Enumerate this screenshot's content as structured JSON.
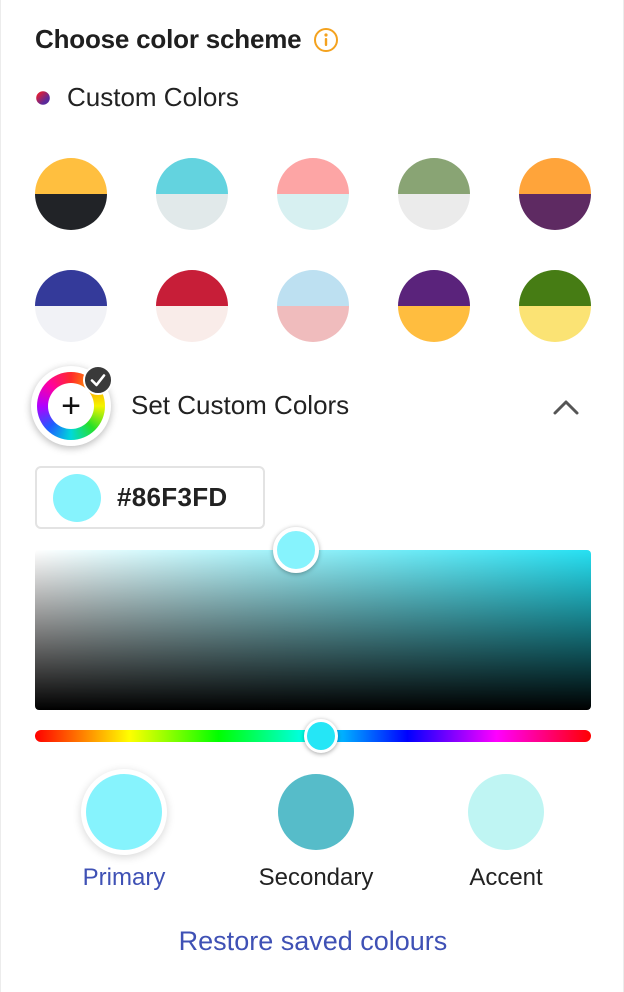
{
  "header": {
    "title": "Choose color scheme",
    "info_icon": "info-circle-icon",
    "info_color": "#f4a21e"
  },
  "current_scheme": {
    "label": "Custom Colors",
    "icon": "color-dot-icon"
  },
  "swatches": [
    {
      "top": "#ffbf3f",
      "bottom": "#212327"
    },
    {
      "top": "#63d3df",
      "bottom": "#e1e9ea"
    },
    {
      "top": "#fda5a5",
      "bottom": "#d7f0f1"
    },
    {
      "top": "#89a474",
      "bottom": "#ebebeb"
    },
    {
      "top": "#ffa43a",
      "bottom": "#5e2a62"
    },
    {
      "top": "#343a9a",
      "bottom": "#f1f2f6"
    },
    {
      "top": "#c71e38",
      "bottom": "#f9ece9"
    },
    {
      "top": "#bde0f1",
      "bottom": "#f0bcbd"
    },
    {
      "top": "#5a237b",
      "bottom": "#ffbd3f"
    },
    {
      "top": "#467c14",
      "bottom": "#fbe374"
    }
  ],
  "custom": {
    "label": "Set Custom Colors",
    "wheel_icon": "color-wheel-plus-icon",
    "check_icon": "check-icon",
    "toggle_icon": "chevron-up-icon",
    "expanded": true
  },
  "picker": {
    "hex": "#86F3FD",
    "saturation": 0.47,
    "brightness": 1.0,
    "hue_fraction": 0.515,
    "hue_handle_color": "#25e6f6"
  },
  "roles": [
    {
      "label": "Primary",
      "color": "#86f3fd",
      "selected": true
    },
    {
      "label": "Secondary",
      "color": "#56bcc9",
      "selected": false
    },
    {
      "label": "Accent",
      "color": "#bff5f3",
      "selected": false
    }
  ],
  "footer": {
    "restore_label": "Restore saved colours"
  },
  "theme": {
    "link_color": "#3f51b5"
  }
}
